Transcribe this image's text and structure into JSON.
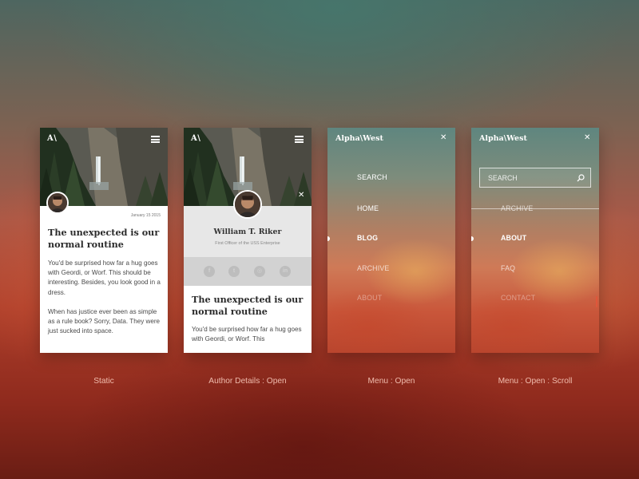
{
  "screens": {
    "static": {
      "logo": "A\\",
      "date": "January 15 2015",
      "title": "The unexpected is our normal routine",
      "paragraphs": [
        "You'd be surprised how far a hug goes with Geordi, or Worf. This should be interesting. Besides, you look good in a dress.",
        "When has justice ever been as simple as a rule book? Sorry, Data. They were just sucked into space."
      ],
      "caption": "Static"
    },
    "author": {
      "logo": "A\\",
      "name": "William T. Riker",
      "role": "First Officer of the USS Enterprise",
      "social": [
        "f",
        "t",
        "◎",
        "in"
      ],
      "title": "The unexpected is our normal routine",
      "body": "You'd be surprised how far a hug goes with Geordi, or Worf. This",
      "caption": "Author Details : Open"
    },
    "menu_open": {
      "brand": "Alpha\\West",
      "items": [
        "SEARCH",
        "HOME",
        "BLOG",
        "ARCHIVE",
        "ABOUT"
      ],
      "active": "BLOG",
      "caption": "Menu : Open"
    },
    "menu_scroll": {
      "brand": "Alpha\\West",
      "search_placeholder": "SEARCH",
      "items": [
        "ARCHIVE",
        "ABOUT",
        "FAQ",
        "CONTACT"
      ],
      "active": "ABOUT",
      "caption": "Menu : Open : Scroll"
    }
  },
  "icons": {
    "hamburger": "menu-icon",
    "close": "close-icon",
    "search": "search-icon"
  },
  "colors": {
    "accent_scroll": "#e0563a",
    "card_bg": "#ffffff",
    "author_panel": "#e7e7e7",
    "social_bar": "#d2d2d2"
  }
}
